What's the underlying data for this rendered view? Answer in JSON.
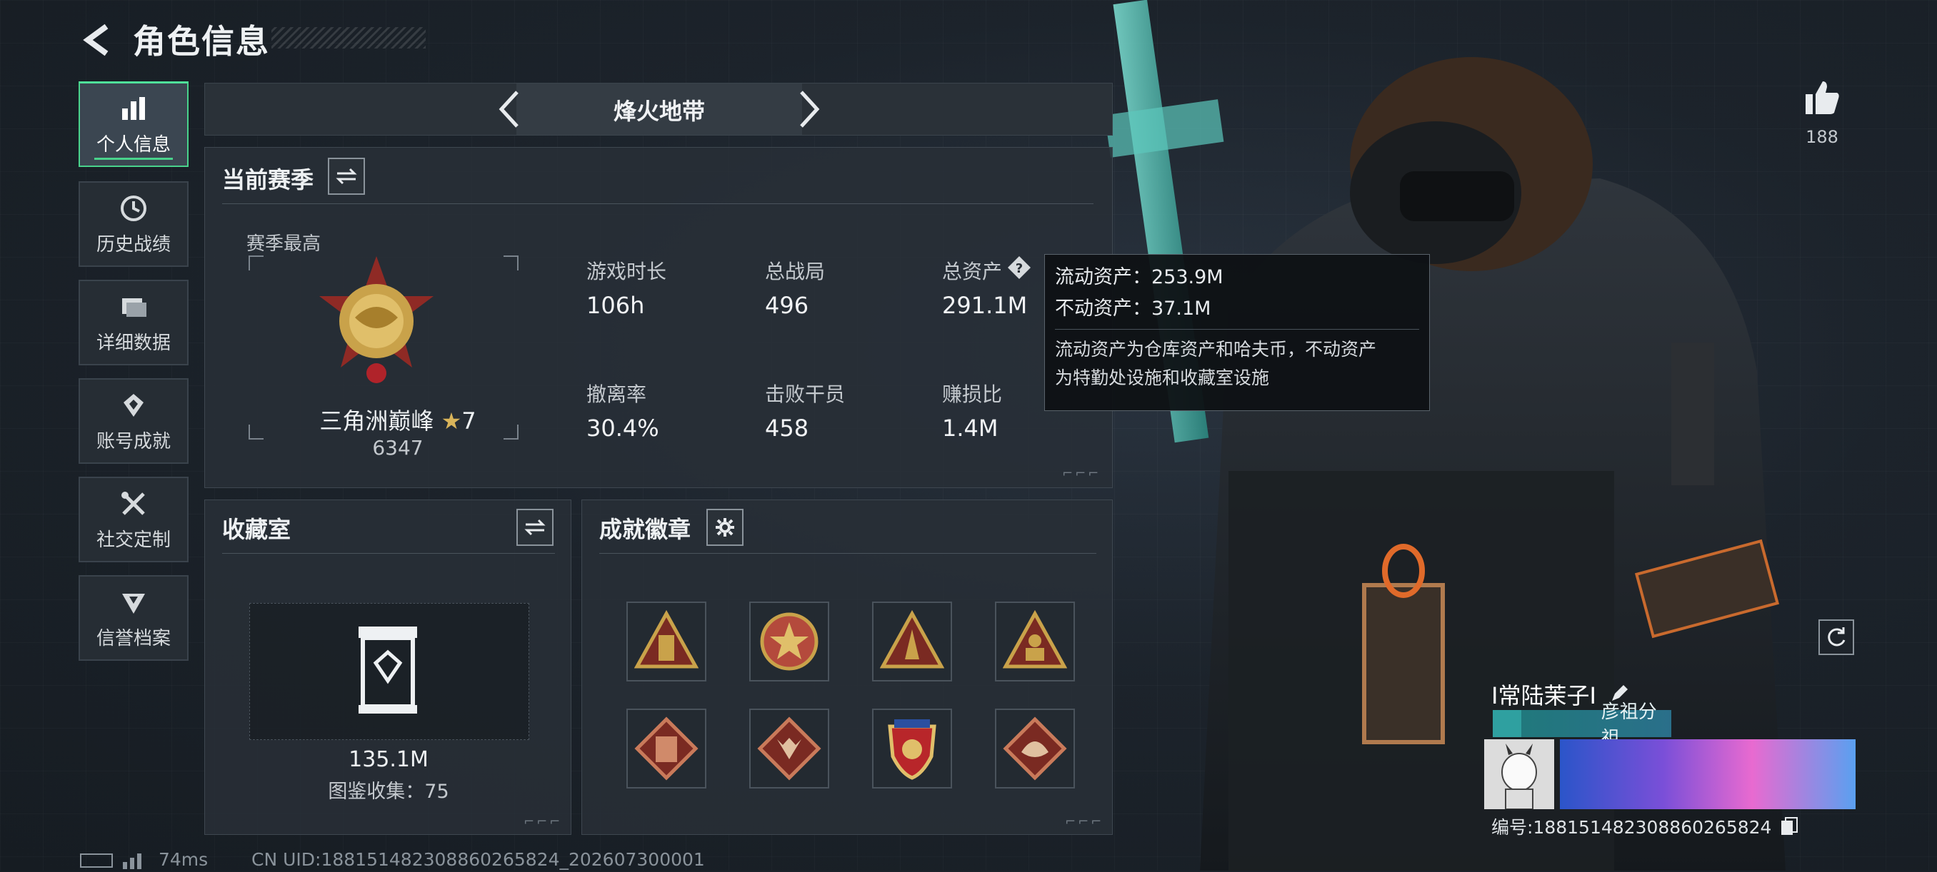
{
  "header": {
    "title": "角色信息"
  },
  "nav": {
    "items": [
      {
        "label": "个人信息",
        "icon": "bar-chart-icon",
        "active": true
      },
      {
        "label": "历史战绩",
        "icon": "clock-icon"
      },
      {
        "label": "详细数据",
        "icon": "folder-icon"
      },
      {
        "label": "账号成就",
        "icon": "trophy-icon"
      },
      {
        "label": "社交定制",
        "icon": "tools-icon"
      },
      {
        "label": "信誉档案",
        "icon": "shield-icon"
      }
    ]
  },
  "mode": {
    "title": "烽火地带"
  },
  "season": {
    "title": "当前赛季",
    "best_label": "赛季最高",
    "rank_name": "三角洲巅峰",
    "rank_stars": "7",
    "rank_points": "6347",
    "stats": [
      {
        "label": "游戏时长",
        "value": "106h"
      },
      {
        "label": "总战局",
        "value": "496"
      },
      {
        "label": "总资产",
        "value": "291.1M"
      },
      {
        "label": "撤离率",
        "value": "30.4%"
      },
      {
        "label": "击败干员",
        "value": "458"
      },
      {
        "label": "赚损比",
        "value": "1.4M"
      }
    ]
  },
  "tooltip": {
    "liquid": "流动资产：253.9M",
    "fixed": "不动资产：37.1M",
    "desc_line1": "流动资产为仓库资产和哈夫币，不动资产",
    "desc_line2": "为特勤处设施和收藏室设施"
  },
  "collection": {
    "title": "收藏室",
    "value": "135.1M",
    "catalog": "图鉴收集：75"
  },
  "achievements": {
    "title": "成就徽章",
    "badges": [
      {
        "icon": "triangle-tower-badge-icon",
        "color": "#c9a24a"
      },
      {
        "icon": "star-medal-badge-icon",
        "color": "#b44a3c"
      },
      {
        "icon": "triangle-rocket-badge-icon",
        "color": "#c9a24a"
      },
      {
        "icon": "triangle-soldier-badge-icon",
        "color": "#c9a24a"
      },
      {
        "icon": "diamond-armor-badge-icon",
        "color": "#b44a3c"
      },
      {
        "icon": "diamond-wolf-badge-icon",
        "color": "#b44a3c"
      },
      {
        "icon": "shield-gold-badge-icon",
        "color": "#c9a24a"
      },
      {
        "icon": "diamond-dragon-badge-icon",
        "color": "#b44a3c"
      }
    ]
  },
  "profile": {
    "likes": "188",
    "name": "I常陆茉子I",
    "guild": "彦祖分祖",
    "uid": "编号:18815148230886026582​4"
  },
  "footer": {
    "ping": "74ms",
    "uid": "CN UID:18815148230886026582​4_202607300001"
  },
  "colors": {
    "accent": "#49d38c",
    "panel": "#283037"
  }
}
